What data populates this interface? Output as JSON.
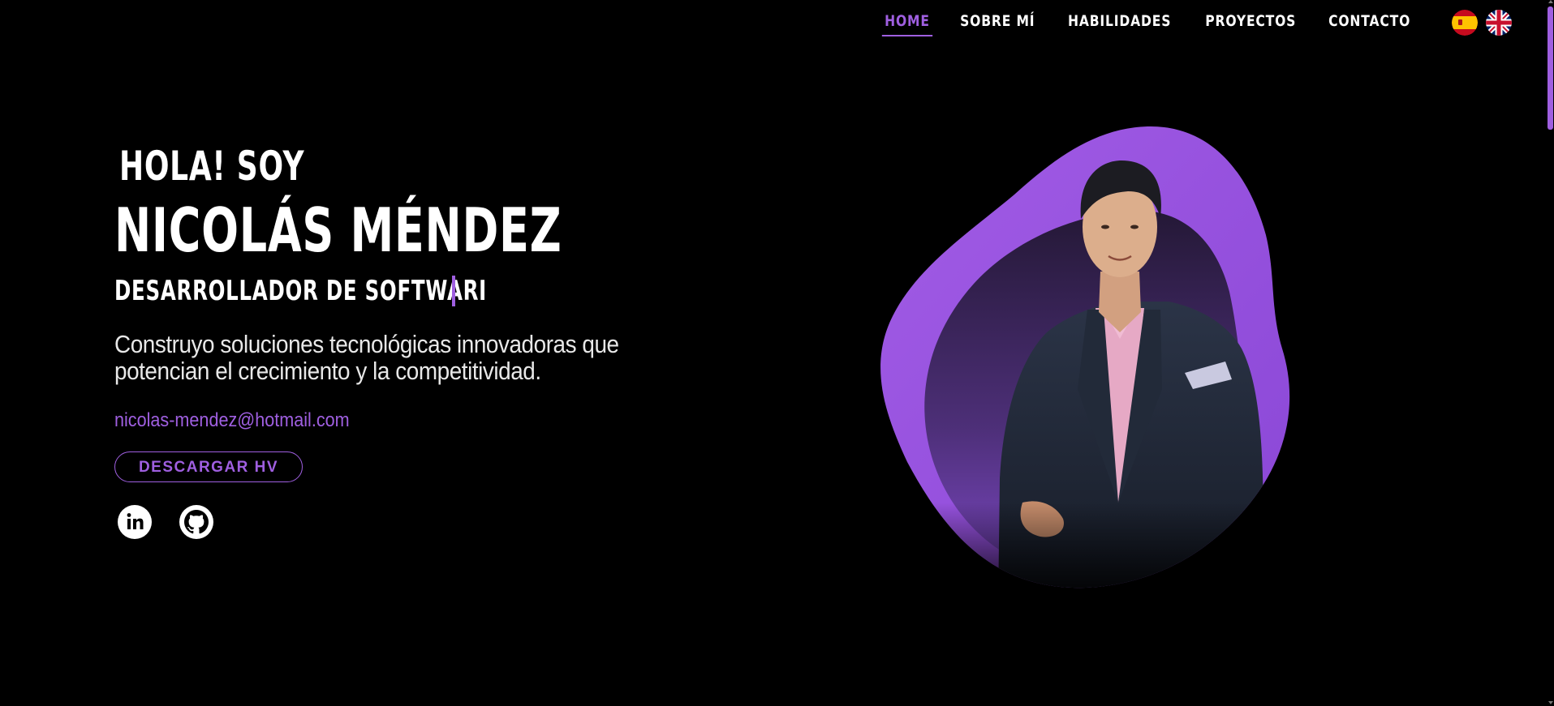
{
  "nav": {
    "items": [
      {
        "label": "HOME",
        "active": true
      },
      {
        "label": "SOBRE MÍ",
        "active": false
      },
      {
        "label": "HABILIDADES",
        "active": false
      },
      {
        "label": "PROYECTOS",
        "active": false
      },
      {
        "label": "CONTACTO",
        "active": false
      }
    ],
    "languages": [
      {
        "icon": "spain-flag-icon"
      },
      {
        "icon": "uk-flag-icon"
      }
    ]
  },
  "hero": {
    "greeting": "HOLA! SOY",
    "name": "NICOLÁS MÉNDEZ",
    "role": "DESARROLLADOR DE SOFTWARI",
    "tagline": "Construyo soluciones tecnológicas innovadoras que potencian el crecimiento y la competitividad.",
    "email": "nicolas-mendez@hotmail.com",
    "cv_button": "DESCARGAR HV",
    "socials": [
      {
        "icon": "linkedin-icon"
      },
      {
        "icon": "github-icon"
      }
    ]
  },
  "theme": {
    "accent": "#9f5fe0",
    "background": "#000000",
    "text": "#ffffff"
  }
}
